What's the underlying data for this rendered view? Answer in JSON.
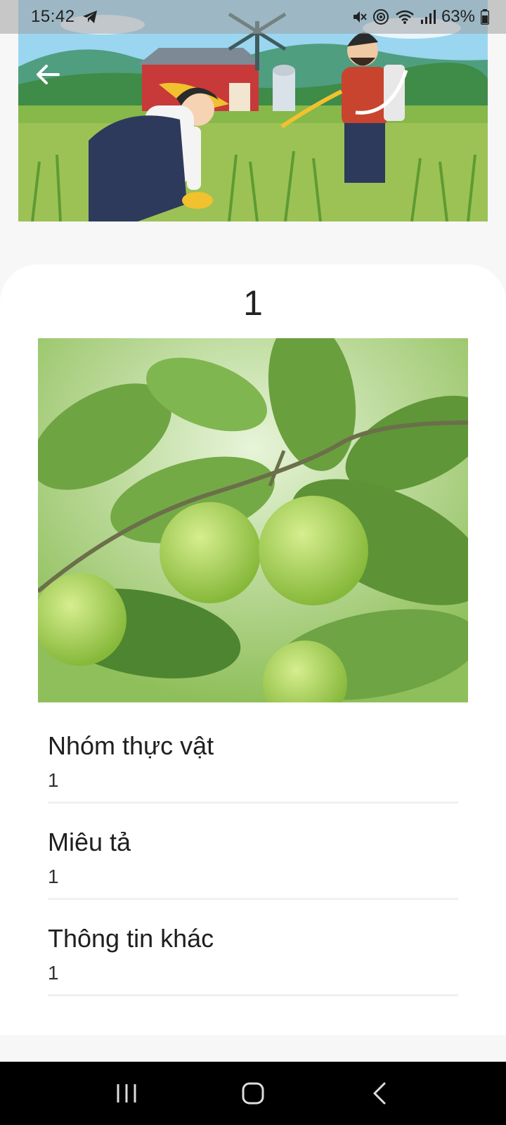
{
  "status_bar": {
    "time": "15:42",
    "battery_percent": "63%",
    "icons": [
      "telegram-icon",
      "mute-icon",
      "hotspot-icon",
      "wifi-icon",
      "signal-icon",
      "battery-icon"
    ]
  },
  "header": {
    "back_icon": "arrow-left-icon",
    "illustration": "farmers-field-illustration"
  },
  "detail": {
    "title": "1",
    "image": "guava-fruit-photo",
    "fields": [
      {
        "label": "Nhóm thực vật",
        "value": "1"
      },
      {
        "label": "Miêu tả",
        "value": "1"
      },
      {
        "label": "Thông tin khác",
        "value": "1"
      }
    ]
  },
  "nav_bar": {
    "icons": [
      "recent-apps-icon",
      "home-icon",
      "back-icon"
    ]
  },
  "colors": {
    "accent_sky": "#8fd0ec",
    "card_bg": "#ffffff",
    "page_bg": "#f7f7f7",
    "nav_bg": "#000000"
  }
}
